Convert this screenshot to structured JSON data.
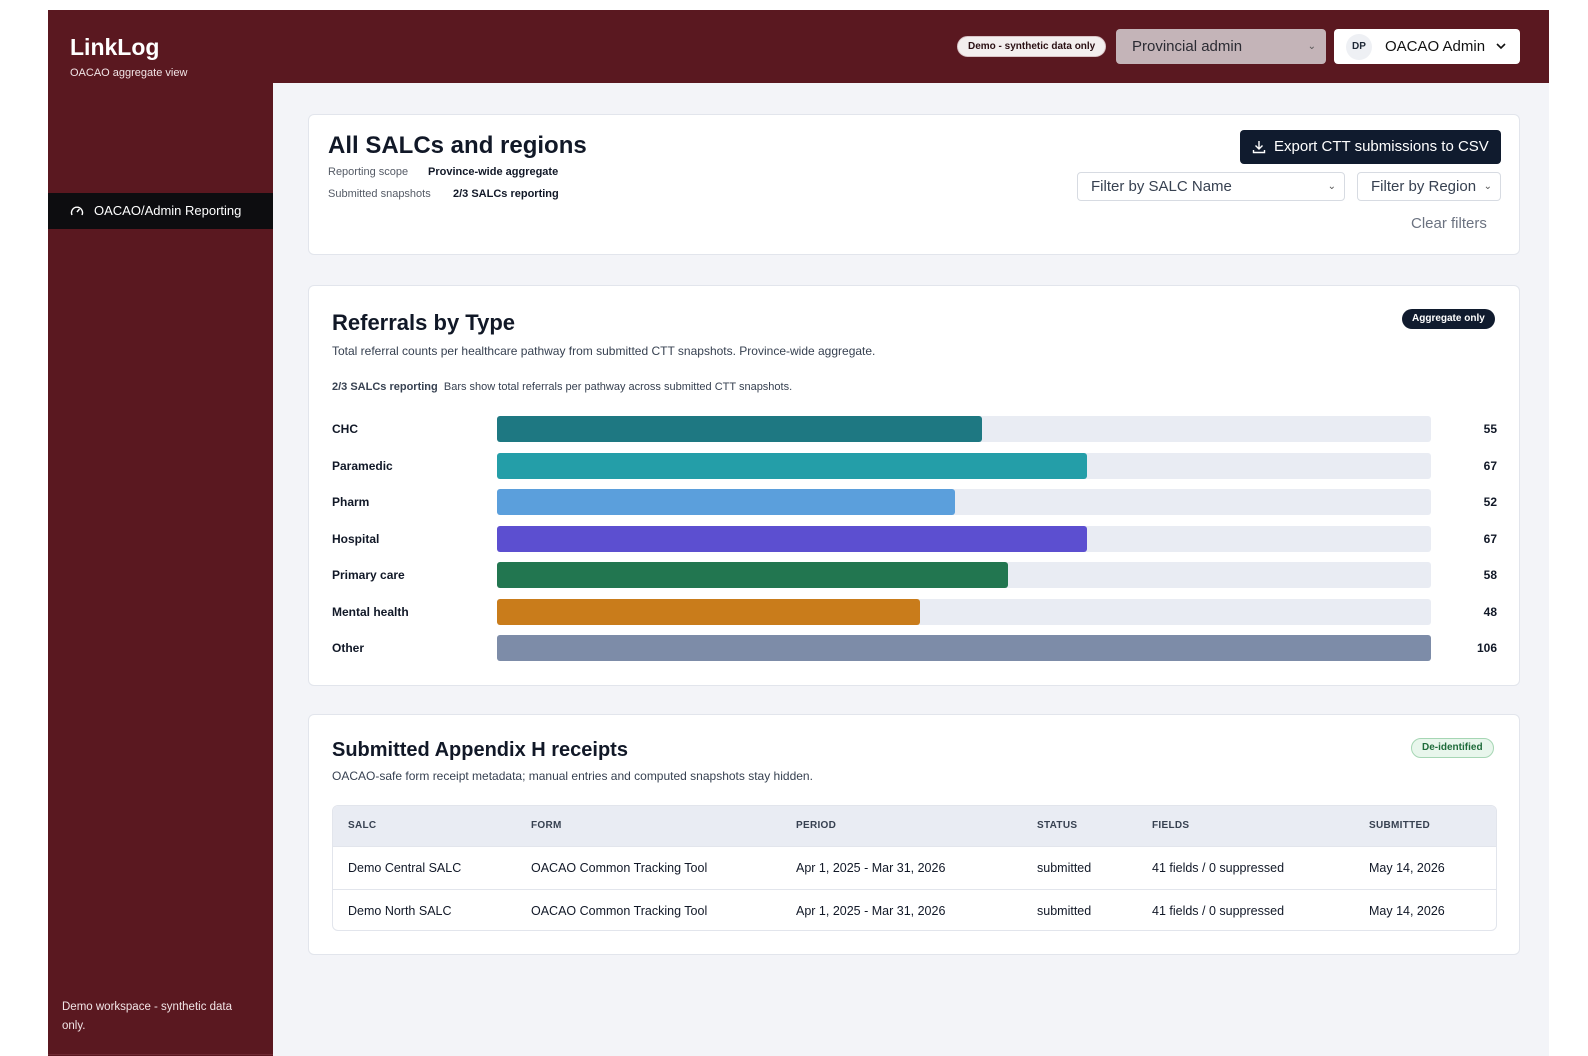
{
  "app": {
    "brand": "LinkLog",
    "brand_sub": "OACAO aggregate view",
    "demo_badge": "Demo - synthetic data only",
    "role_select": "Provincial admin",
    "user": {
      "initials": "DP",
      "name": "OACAO Admin"
    }
  },
  "sidebar": {
    "items": [
      {
        "label": "OACAO/Admin Reporting",
        "icon": "gauge-icon"
      }
    ],
    "footer": "Demo workspace - synthetic data only."
  },
  "summary": {
    "title": "All SALCs and regions",
    "scope_label": "Reporting scope",
    "scope_value": "Province-wide aggregate",
    "snapshots_label": "Submitted snapshots",
    "snapshots_value": "2/3 SALCs reporting",
    "export_label": "Export CTT submissions to CSV",
    "filter_salc": "Filter by SALC Name",
    "filter_region": "Filter by Region",
    "clear_filters": "Clear filters"
  },
  "referrals": {
    "title": "Referrals by Type",
    "subtitle": "Total referral counts per healthcare pathway from submitted CTT snapshots. Province-wide aggregate.",
    "badge": "Aggregate only",
    "note_strong": "2/3 SALCs reporting",
    "note": "Bars show total referrals per pathway across submitted CTT snapshots."
  },
  "chart_data": {
    "type": "bar",
    "orientation": "horizontal",
    "categories": [
      "CHC",
      "Paramedic",
      "Pharm",
      "Hospital",
      "Primary care",
      "Mental health",
      "Other"
    ],
    "values": [
      55,
      67,
      52,
      67,
      58,
      48,
      106
    ],
    "xlim": [
      0,
      106
    ],
    "colors": [
      "#1e7882",
      "#249ea8",
      "#5b9fdc",
      "#5c4fd0",
      "#227650",
      "#c97c1b",
      "#7d8ca8"
    ]
  },
  "receipts": {
    "title": "Submitted Appendix H receipts",
    "subtitle": "OACAO-safe form receipt metadata; manual entries and computed snapshots stay hidden.",
    "badge": "De-identified",
    "columns": [
      "SALC",
      "FORM",
      "PERIOD",
      "STATUS",
      "FIELDS",
      "SUBMITTED"
    ],
    "rows": [
      [
        "Demo Central SALC",
        "OACAO Common Tracking Tool",
        "Apr 1, 2025 - Mar 31, 2026",
        "submitted",
        "41 fields / 0 suppressed",
        "May 14, 2026"
      ],
      [
        "Demo North SALC",
        "OACAO Common Tracking Tool",
        "Apr 1, 2025 - Mar 31, 2026",
        "submitted",
        "41 fields / 0 suppressed",
        "May 14, 2026"
      ]
    ]
  }
}
